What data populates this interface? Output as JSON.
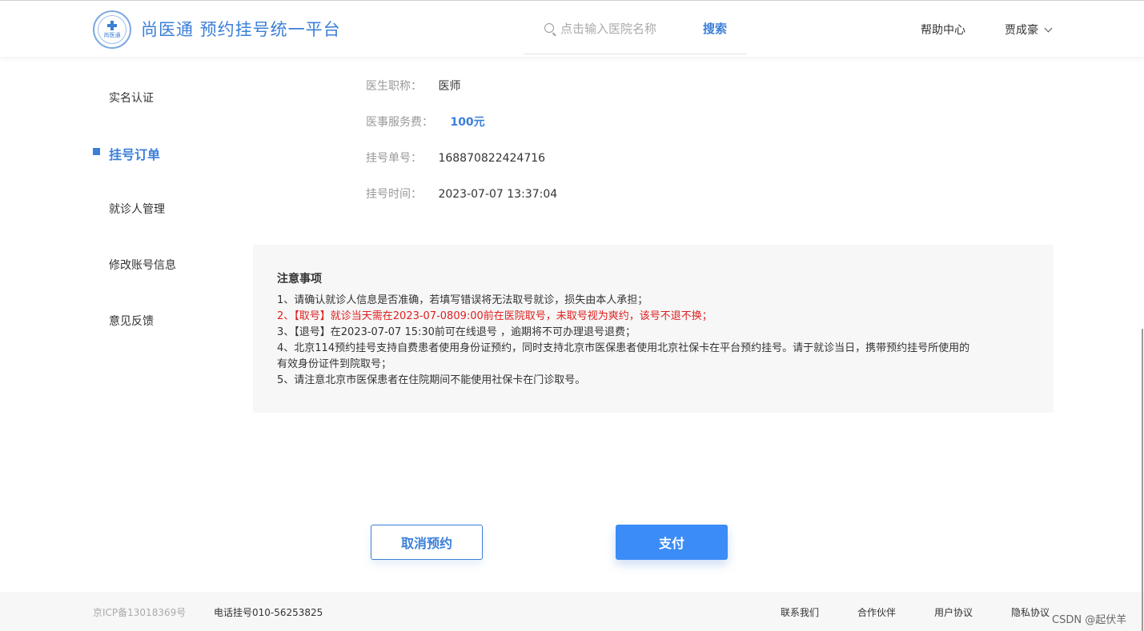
{
  "header": {
    "logo_text": "尚医通",
    "site_title": "尚医通 预约挂号统一平台",
    "search": {
      "placeholder": "点击输入医院名称",
      "button_label": "搜索"
    },
    "help_label": "帮助中心",
    "user_name": "贾成豪"
  },
  "sidebar": {
    "items": [
      {
        "label": "实名认证"
      },
      {
        "label": "挂号订单"
      },
      {
        "label": "就诊人管理"
      },
      {
        "label": "修改账号信息"
      },
      {
        "label": "意见反馈"
      }
    ],
    "active_index": 1
  },
  "order": {
    "doctor_title_label": "医生职称：",
    "doctor_title_value": "医师",
    "fee_label": "医事服务费：",
    "fee_value": "100元",
    "order_no_label": "挂号单号：",
    "order_no_value": "168870822424716",
    "time_label": "挂号时间：",
    "time_value": "2023-07-07 13:37:04"
  },
  "notice": {
    "title": "注意事项",
    "lines": [
      "1、请确认就诊人信息是否准确，若填写错误将无法取号就诊，损失由本人承担；",
      "2、【取号】就诊当天需在2023-07-0809:00前在医院取号，未取号视为爽约，该号不退不换；",
      "3、【退号】在2023-07-07 15:30前可在线退号 ，逾期将不可办理退号退费；",
      "4、北京114预约挂号支持自费患者使用身份证预约，同时支持北京市医保患者使用北京社保卡在平台预约挂号。请于就诊当日，携带预约挂号所使用的",
      "有效身份证件到院取号；",
      "5、请注意北京市医保患者在住院期间不能使用社保卡在门诊取号。"
    ]
  },
  "actions": {
    "cancel_label": "取消预约",
    "pay_label": "支付"
  },
  "footer": {
    "icp": "京ICP备13018369号",
    "phone": "电话挂号010-56253825",
    "links": [
      "联系我们",
      "合作伙伴",
      "用户协议",
      "隐私协议"
    ],
    "watermark": "CSDN @起伏羊"
  },
  "colors": {
    "primary": "#3b7fd8",
    "warning": "#e02020",
    "notice_bg": "#f7f7f7"
  }
}
